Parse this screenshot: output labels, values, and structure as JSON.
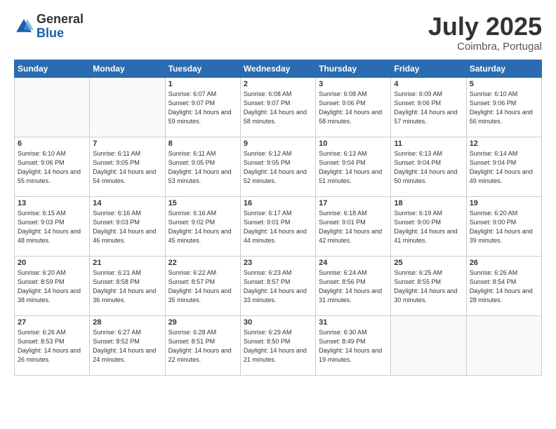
{
  "header": {
    "logo_general": "General",
    "logo_blue": "Blue",
    "month_title": "July 2025",
    "location": "Coimbra, Portugal"
  },
  "days_of_week": [
    "Sunday",
    "Monday",
    "Tuesday",
    "Wednesday",
    "Thursday",
    "Friday",
    "Saturday"
  ],
  "weeks": [
    [
      {
        "day": "",
        "info": ""
      },
      {
        "day": "",
        "info": ""
      },
      {
        "day": "1",
        "info": "Sunrise: 6:07 AM\nSunset: 9:07 PM\nDaylight: 14 hours and 59 minutes."
      },
      {
        "day": "2",
        "info": "Sunrise: 6:08 AM\nSunset: 9:07 PM\nDaylight: 14 hours and 58 minutes."
      },
      {
        "day": "3",
        "info": "Sunrise: 6:08 AM\nSunset: 9:06 PM\nDaylight: 14 hours and 58 minutes."
      },
      {
        "day": "4",
        "info": "Sunrise: 6:09 AM\nSunset: 9:06 PM\nDaylight: 14 hours and 57 minutes."
      },
      {
        "day": "5",
        "info": "Sunrise: 6:10 AM\nSunset: 9:06 PM\nDaylight: 14 hours and 56 minutes."
      }
    ],
    [
      {
        "day": "6",
        "info": "Sunrise: 6:10 AM\nSunset: 9:06 PM\nDaylight: 14 hours and 55 minutes."
      },
      {
        "day": "7",
        "info": "Sunrise: 6:11 AM\nSunset: 9:05 PM\nDaylight: 14 hours and 54 minutes."
      },
      {
        "day": "8",
        "info": "Sunrise: 6:11 AM\nSunset: 9:05 PM\nDaylight: 14 hours and 53 minutes."
      },
      {
        "day": "9",
        "info": "Sunrise: 6:12 AM\nSunset: 9:05 PM\nDaylight: 14 hours and 52 minutes."
      },
      {
        "day": "10",
        "info": "Sunrise: 6:13 AM\nSunset: 9:04 PM\nDaylight: 14 hours and 51 minutes."
      },
      {
        "day": "11",
        "info": "Sunrise: 6:13 AM\nSunset: 9:04 PM\nDaylight: 14 hours and 50 minutes."
      },
      {
        "day": "12",
        "info": "Sunrise: 6:14 AM\nSunset: 9:04 PM\nDaylight: 14 hours and 49 minutes."
      }
    ],
    [
      {
        "day": "13",
        "info": "Sunrise: 6:15 AM\nSunset: 9:03 PM\nDaylight: 14 hours and 48 minutes."
      },
      {
        "day": "14",
        "info": "Sunrise: 6:16 AM\nSunset: 9:03 PM\nDaylight: 14 hours and 46 minutes."
      },
      {
        "day": "15",
        "info": "Sunrise: 6:16 AM\nSunset: 9:02 PM\nDaylight: 14 hours and 45 minutes."
      },
      {
        "day": "16",
        "info": "Sunrise: 6:17 AM\nSunset: 9:01 PM\nDaylight: 14 hours and 44 minutes."
      },
      {
        "day": "17",
        "info": "Sunrise: 6:18 AM\nSunset: 9:01 PM\nDaylight: 14 hours and 42 minutes."
      },
      {
        "day": "18",
        "info": "Sunrise: 6:19 AM\nSunset: 9:00 PM\nDaylight: 14 hours and 41 minutes."
      },
      {
        "day": "19",
        "info": "Sunrise: 6:20 AM\nSunset: 9:00 PM\nDaylight: 14 hours and 39 minutes."
      }
    ],
    [
      {
        "day": "20",
        "info": "Sunrise: 6:20 AM\nSunset: 8:59 PM\nDaylight: 14 hours and 38 minutes."
      },
      {
        "day": "21",
        "info": "Sunrise: 6:21 AM\nSunset: 8:58 PM\nDaylight: 14 hours and 36 minutes."
      },
      {
        "day": "22",
        "info": "Sunrise: 6:22 AM\nSunset: 8:57 PM\nDaylight: 14 hours and 35 minutes."
      },
      {
        "day": "23",
        "info": "Sunrise: 6:23 AM\nSunset: 8:57 PM\nDaylight: 14 hours and 33 minutes."
      },
      {
        "day": "24",
        "info": "Sunrise: 6:24 AM\nSunset: 8:56 PM\nDaylight: 14 hours and 31 minutes."
      },
      {
        "day": "25",
        "info": "Sunrise: 6:25 AM\nSunset: 8:55 PM\nDaylight: 14 hours and 30 minutes."
      },
      {
        "day": "26",
        "info": "Sunrise: 6:26 AM\nSunset: 8:54 PM\nDaylight: 14 hours and 28 minutes."
      }
    ],
    [
      {
        "day": "27",
        "info": "Sunrise: 6:26 AM\nSunset: 8:53 PM\nDaylight: 14 hours and 26 minutes."
      },
      {
        "day": "28",
        "info": "Sunrise: 6:27 AM\nSunset: 8:52 PM\nDaylight: 14 hours and 24 minutes."
      },
      {
        "day": "29",
        "info": "Sunrise: 6:28 AM\nSunset: 8:51 PM\nDaylight: 14 hours and 22 minutes."
      },
      {
        "day": "30",
        "info": "Sunrise: 6:29 AM\nSunset: 8:50 PM\nDaylight: 14 hours and 21 minutes."
      },
      {
        "day": "31",
        "info": "Sunrise: 6:30 AM\nSunset: 8:49 PM\nDaylight: 14 hours and 19 minutes."
      },
      {
        "day": "",
        "info": ""
      },
      {
        "day": "",
        "info": ""
      }
    ]
  ]
}
